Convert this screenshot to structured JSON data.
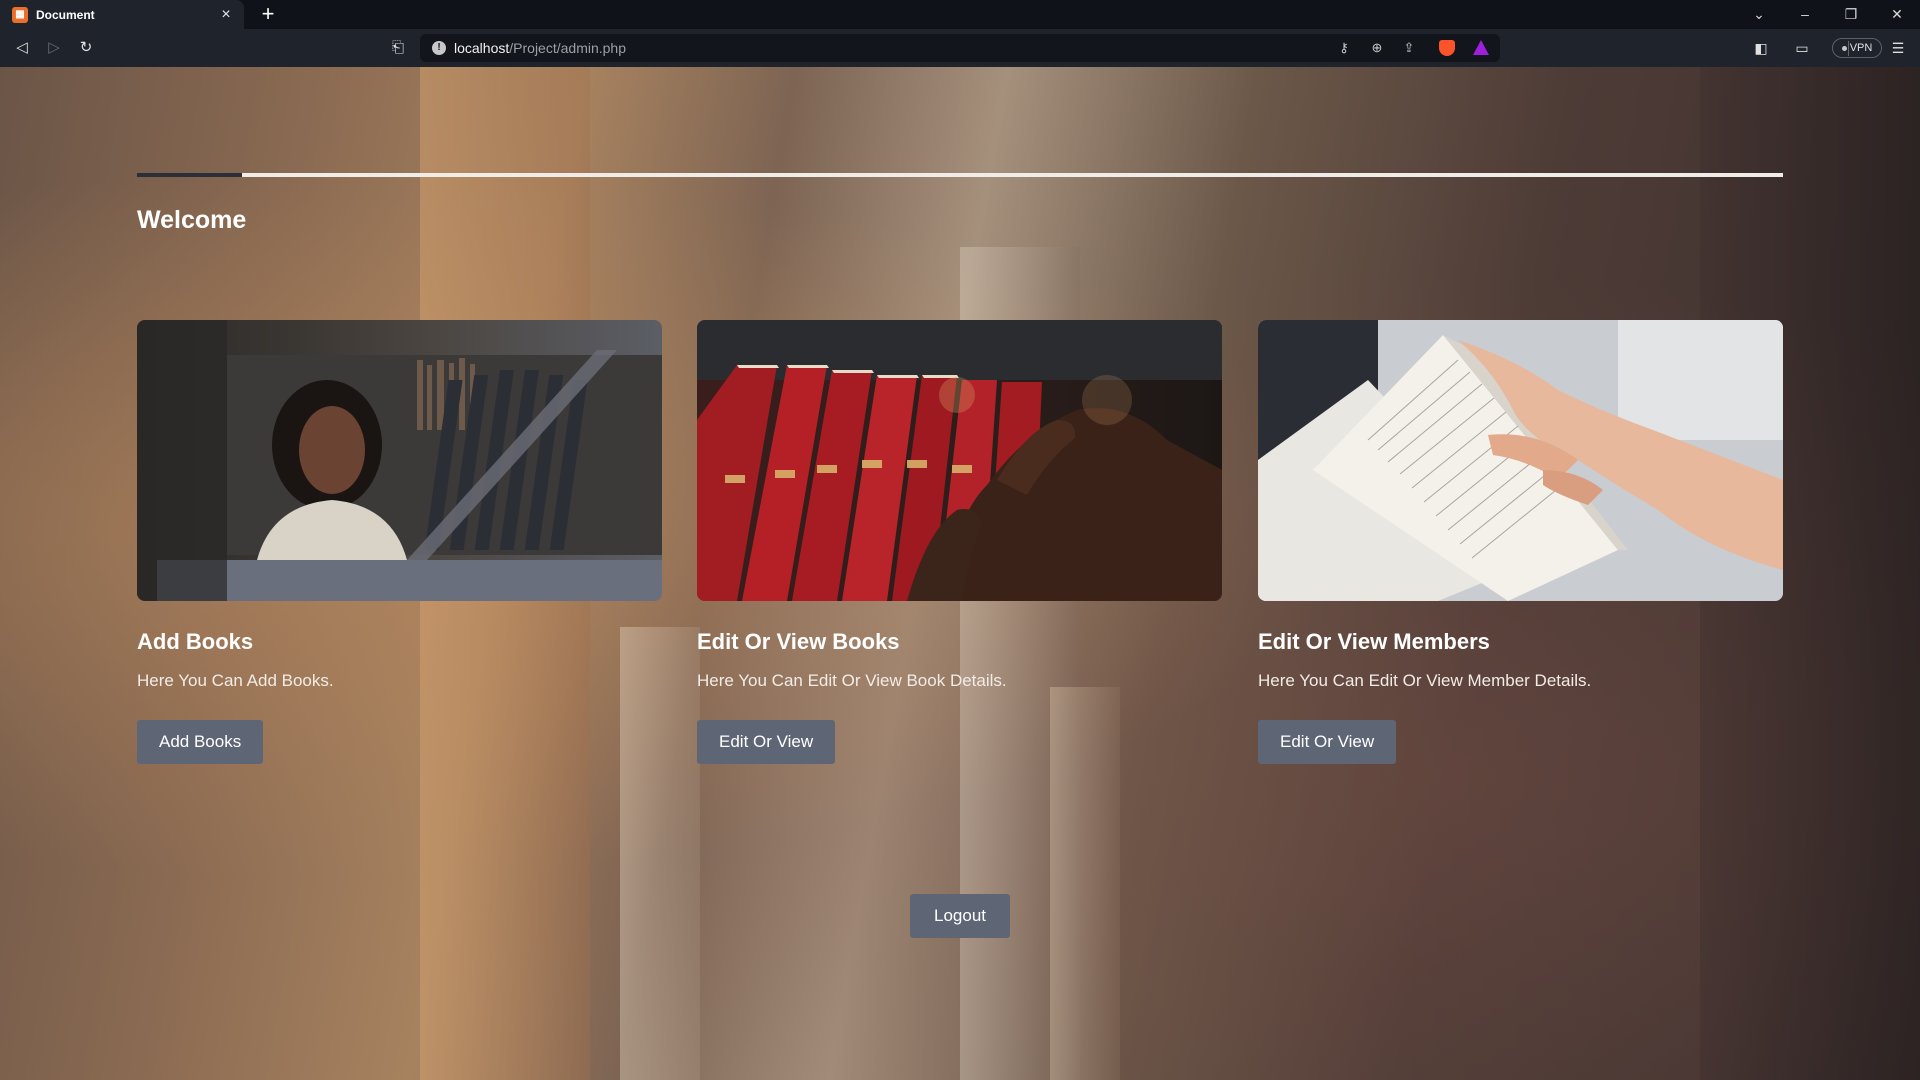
{
  "browser": {
    "tab_title": "Document",
    "tab_close": "×",
    "new_tab": "+",
    "url_host": "localhost",
    "url_path": "/Project/admin.php",
    "vpn_label": "VPN",
    "icons": [
      "back-icon",
      "forward-icon",
      "reload-icon",
      "bookmark-icon",
      "key-icon",
      "zoom-icon",
      "share-icon",
      "brave-shield-icon",
      "brave-rewards-icon",
      "sidebar-icon",
      "wallet-icon",
      "menu-icon"
    ]
  },
  "page": {
    "progress": 0.064,
    "welcome": "Welcome",
    "cards": [
      {
        "title": "Add Books",
        "description": "Here You Can Add Books.",
        "button": "Add Books"
      },
      {
        "title": "Edit Or View Books",
        "description": "Here You Can Edit Or View Book Details.",
        "button": "Edit Or View"
      },
      {
        "title": "Edit Or View Members",
        "description": "Here You Can Edit Or View Member Details.",
        "button": "Edit Or View"
      }
    ],
    "logout": "Logout"
  },
  "colors": {
    "button_bg": "#5e6676",
    "favicon": "#e8702a",
    "brave": "#fb542b",
    "rewards": "#9e1fdc"
  }
}
